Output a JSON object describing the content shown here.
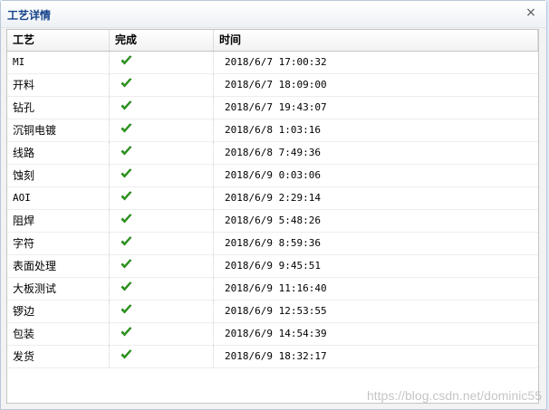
{
  "dialog": {
    "title": "工艺详情",
    "close_glyph": "×"
  },
  "grid": {
    "headers": [
      "工艺",
      "完成",
      "时间"
    ],
    "rows": [
      {
        "process": "MI",
        "done": true,
        "time": "2018/6/7 17:00:32"
      },
      {
        "process": "开料",
        "done": true,
        "time": "2018/6/7 18:09:00"
      },
      {
        "process": "钻孔",
        "done": true,
        "time": "2018/6/7 19:43:07"
      },
      {
        "process": "沉铜电镀",
        "done": true,
        "time": "2018/6/8 1:03:16"
      },
      {
        "process": "线路",
        "done": true,
        "time": "2018/6/8 7:49:36"
      },
      {
        "process": "蚀刻",
        "done": true,
        "time": "2018/6/9 0:03:06"
      },
      {
        "process": "AOI",
        "done": true,
        "time": "2018/6/9 2:29:14"
      },
      {
        "process": "阻焊",
        "done": true,
        "time": "2018/6/9 5:48:26"
      },
      {
        "process": "字符",
        "done": true,
        "time": "2018/6/9 8:59:36"
      },
      {
        "process": "表面处理",
        "done": true,
        "time": "2018/6/9 9:45:51"
      },
      {
        "process": "大板测试",
        "done": true,
        "time": "2018/6/9 11:16:40"
      },
      {
        "process": "锣边",
        "done": true,
        "time": "2018/6/9 12:53:55"
      },
      {
        "process": "包装",
        "done": true,
        "time": "2018/6/9 14:54:39"
      },
      {
        "process": "发货",
        "done": true,
        "time": "2018/6/9 18:32:17"
      }
    ]
  },
  "watermark": "https://blog.csdn.net/dominic55",
  "colors": {
    "title": "#15428b",
    "check": "#2f9e1f"
  },
  "icons": {
    "done": "checkmark-icon",
    "close": "close-icon"
  }
}
